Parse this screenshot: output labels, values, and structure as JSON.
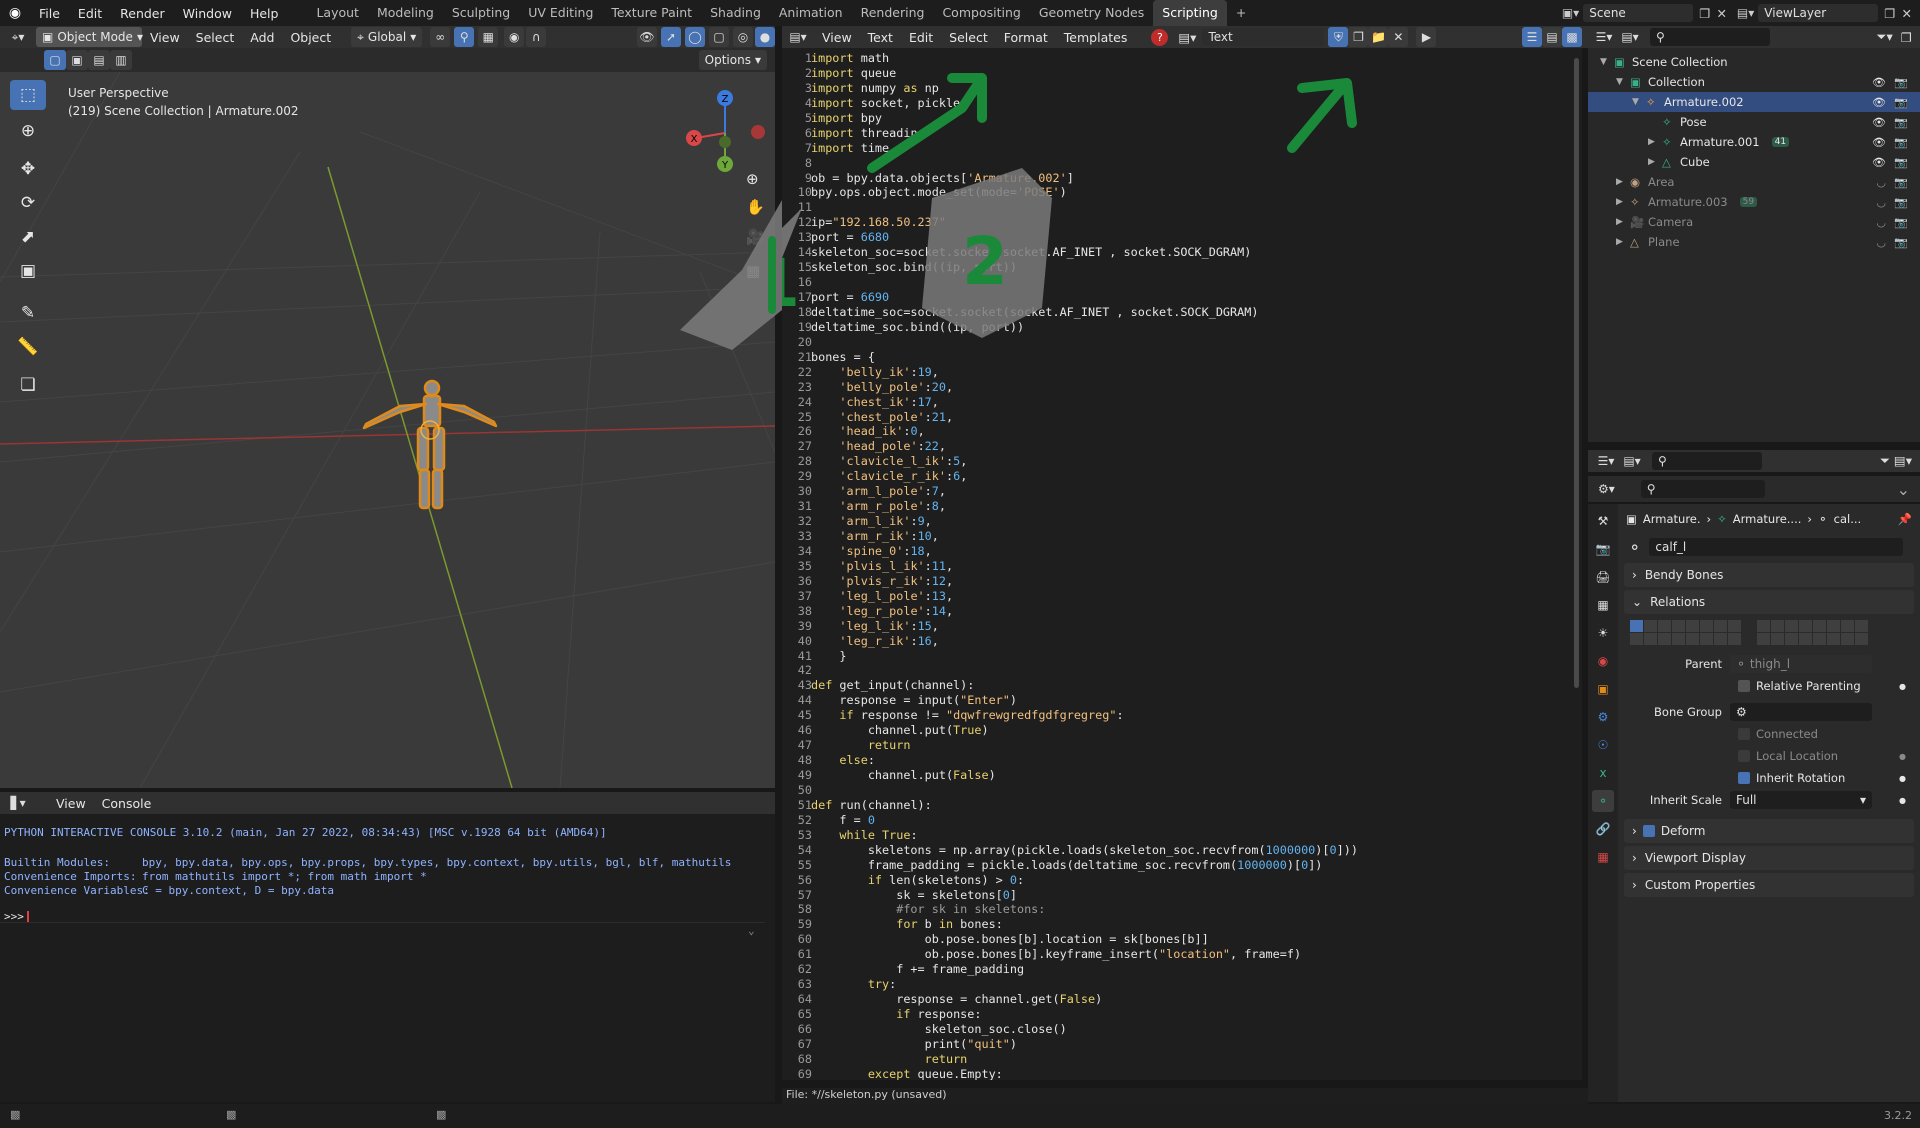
{
  "topbar": {
    "menus": [
      "File",
      "Edit",
      "Render",
      "Window",
      "Help"
    ],
    "workspaces": [
      "Layout",
      "Modeling",
      "Sculpting",
      "UV Editing",
      "Texture Paint",
      "Shading",
      "Animation",
      "Rendering",
      "Compositing",
      "Geometry Nodes",
      "Scripting"
    ],
    "active_workspace": "Scripting",
    "add_tab": "+",
    "scene": "Scene",
    "viewlayer": "ViewLayer"
  },
  "viewport": {
    "mode": "Object Mode",
    "menus": [
      "View",
      "Select",
      "Add",
      "Object"
    ],
    "orientation": "Global",
    "options": "Options",
    "title": "User Perspective",
    "subtitle": "(219) Scene Collection | Armature.002",
    "gizmo": {
      "z": "Z",
      "x": "X",
      "y": "Y"
    }
  },
  "editor": {
    "menus": [
      "View",
      "Text",
      "Edit",
      "Select",
      "Format",
      "Templates"
    ],
    "text_name": "Text",
    "file_status": "File: *//skeleton.py (unsaved)",
    "lines": [
      "import math",
      "import queue",
      "import numpy as np",
      "import socket, pickle",
      "import bpy",
      "import threading",
      "import time",
      "",
      "ob = bpy.data.objects['Armature.002']",
      "bpy.ops.object.mode_set(mode='POSE')",
      "",
      "ip=\"192.168.50.237\"",
      "port = 6680",
      "skeleton_soc=socket.socket(socket.AF_INET , socket.SOCK_DGRAM)",
      "skeleton_soc.bind((ip, port))",
      "",
      "port = 6690",
      "deltatime_soc=socket.socket(socket.AF_INET , socket.SOCK_DGRAM)",
      "deltatime_soc.bind((ip, port))",
      "",
      "bones = {",
      "    'belly_ik':19,",
      "    'belly_pole':20,",
      "    'chest_ik':17,",
      "    'chest_pole':21,",
      "    'head_ik':0,",
      "    'head_pole':22,",
      "    'clavicle_l_ik':5,",
      "    'clavicle_r_ik':6,",
      "    'arm_l_pole':7,",
      "    'arm_r_pole':8,",
      "    'arm_l_ik':9,",
      "    'arm_r_ik':10,",
      "    'spine_0':18,",
      "    'plvis_l_ik':11,",
      "    'plvis_r_ik':12,",
      "    'leg_l_pole':13,",
      "    'leg_r_pole':14,",
      "    'leg_l_ik':15,",
      "    'leg_r_ik':16,",
      "    }",
      "",
      "def get_input(channel):",
      "    response = input(\"Enter\")",
      "    if response != \"dqwfrewgredfgdfgregreg\":",
      "        channel.put(True)",
      "        return",
      "    else:",
      "        channel.put(False)",
      "",
      "def run(channel):",
      "    f = 0",
      "    while True:",
      "        skeletons = np.array(pickle.loads(skeleton_soc.recvfrom(1000000)[0]))",
      "        frame_padding = pickle.loads(deltatime_soc.recvfrom(1000000)[0])",
      "        if len(skeletons) > 0:",
      "            sk = skeletons[0]",
      "            #for sk in skeletons:",
      "            for b in bones:",
      "                ob.pose.bones[b].location = sk[bones[b]]",
      "                ob.pose.bones[b].keyframe_insert(\"location\", frame=f)",
      "            f += frame_padding",
      "        try:",
      "            response = channel.get(False)",
      "            if response:",
      "                skeleton_soc.close()",
      "                print(\"quit\")",
      "                return",
      "        except queue.Empty:"
    ]
  },
  "annotations": {
    "mark1": "1",
    "mark2": "2"
  },
  "console": {
    "menus": [
      "View",
      "Console"
    ],
    "header": "PYTHON INTERACTIVE CONSOLE 3.10.2 (main, Jan 27 2022, 08:34:43) [MSC v.1928 64 bit (AMD64)]",
    "rows": [
      {
        "label": "Builtin Modules:",
        "value": "bpy, bpy.data, bpy.ops, bpy.props, bpy.types, bpy.context, bpy.utils, bgl, blf, mathutils"
      },
      {
        "label": "Convenience Imports:",
        "value": "from mathutils import *; from math import *"
      },
      {
        "label": "Convenience Variables:",
        "value": "C = bpy.context, D = bpy.data"
      }
    ],
    "prompt": ">>>"
  },
  "outliner": {
    "items": [
      {
        "label": "Scene Collection",
        "indent": 0
      },
      {
        "label": "Collection",
        "indent": 1
      },
      {
        "label": "Armature.002",
        "indent": 2,
        "selected": true
      },
      {
        "label": "Pose",
        "indent": 3
      },
      {
        "label": "Armature.001",
        "indent": 3,
        "badge": "41"
      },
      {
        "label": "Cube",
        "indent": 3
      },
      {
        "label": "Area",
        "indent": 1,
        "dim": true
      },
      {
        "label": "Armature.003",
        "indent": 1,
        "dim": true,
        "badge": "59"
      },
      {
        "label": "Camera",
        "indent": 1,
        "dim": true
      },
      {
        "label": "Plane",
        "indent": 1,
        "dim": true
      }
    ]
  },
  "properties": {
    "breadcrumb": [
      "Armature.",
      "Armature....",
      "cal..."
    ],
    "bone_name": "calf_l",
    "panels": {
      "bendy": "Bendy Bones",
      "relations": "Relations",
      "deform": "Deform",
      "viewport": "Viewport Display",
      "custom": "Custom Properties"
    },
    "parent_label": "Parent",
    "parent_value": "thigh_l",
    "relative_parenting": "Relative Parenting",
    "bone_group_label": "Bone Group",
    "connected": "Connected",
    "local_location": "Local Location",
    "inherit_rotation": "Inherit Rotation",
    "inherit_scale_label": "Inherit Scale",
    "inherit_scale_value": "Full"
  },
  "status": {
    "version": "3.2.2"
  },
  "colors": {
    "accent": "#4772b3",
    "selected": "#334d80",
    "keyword": "#e8d26e",
    "string": "#f0c080",
    "number": "#63b4f2",
    "annotation": "#1a8a3a"
  }
}
